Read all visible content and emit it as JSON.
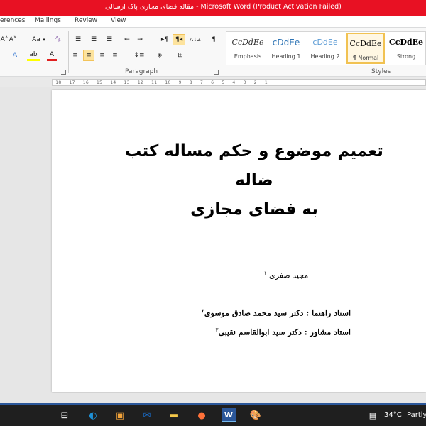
{
  "window": {
    "title": "مقاله فضای مجازی پاک ارسالی  -  Microsoft Word (Product Activation Failed)"
  },
  "ribbon": {
    "tabs": [
      "erences",
      "Mailings",
      "Review",
      "View"
    ],
    "font_group": {
      "grow_font": "A˄",
      "shrink_font": "A˅",
      "change_case": "Aa",
      "change_case_arrow": "▾",
      "clear_format": "ᴬᵦ",
      "text_effects": "A",
      "highlight": "ab",
      "font_color": "A"
    },
    "paragraph_group": {
      "label": "Paragraph",
      "bullets": "☰",
      "numbering": "☰",
      "multilevel": "☰",
      "decrease_indent": "⇤",
      "increase_indent": "⇥",
      "ltr": "▸¶",
      "rtl": "¶◂",
      "sort": "A↓Z",
      "show_marks": "¶",
      "align_left": "≡",
      "align_center": "≡",
      "align_right": "≡",
      "justify": "≡",
      "line_spacing": "↕≡",
      "shading": "◈",
      "borders": "⊞"
    },
    "styles_group": {
      "label": "Styles",
      "items": [
        {
          "preview": "CcDdEe",
          "name": "Emphasis"
        },
        {
          "preview": "cDdEe",
          "name": "Heading 1"
        },
        {
          "preview": "cDdEe",
          "name": "Heading 2"
        },
        {
          "preview": "CcDdEe",
          "name": "¶ Normal"
        },
        {
          "preview": "CcDdEe",
          "name": "Strong"
        }
      ]
    }
  },
  "ruler": {
    "ticks": "·18·  ·  ·17·  ·  ·16·  ·  ·15·  ·  ·14·  ·  ·13·  ·  ·12·  ·  ·11·  ·  ·10·  ·  ·9·  ·  ·8·  ·  ·7·  ·  ·6·  ·  ·5·  ·  ·4·  ·  ·3·  ·  ·2·  ·  ·1·"
  },
  "document": {
    "title_line1": "تعمیم موضوع و حکم مساله کتب ضاله",
    "title_line2": "به فضای مجازی",
    "author": "مجید صفری",
    "author_note": "۱",
    "advisor_line": "استاد راهنما : دکتر سید محمد صادق موسوی",
    "advisor_note": "۲",
    "consultant_line": "استاد مشاور : دکتر سید ابوالقاسم نقیبی",
    "consultant_note": "۳"
  },
  "taskbar": {
    "icons": [
      {
        "name": "task-view",
        "glyph": "⊟"
      },
      {
        "name": "edge",
        "glyph": "◐",
        "color": "#1e90d6"
      },
      {
        "name": "store",
        "glyph": "▣",
        "color": "#f2a33a"
      },
      {
        "name": "mail",
        "glyph": "✉",
        "color": "#1a73d9"
      },
      {
        "name": "file-explorer",
        "glyph": "▬",
        "color": "#f4c84a"
      },
      {
        "name": "firefox",
        "glyph": "●",
        "color": "#ff7139"
      },
      {
        "name": "word",
        "glyph": "W",
        "color": "#2b579a"
      },
      {
        "name": "paint",
        "glyph": "🎨",
        "color": "#aaaaaa"
      }
    ],
    "weather_temp": "34°C",
    "weather_desc": "Partly"
  }
}
